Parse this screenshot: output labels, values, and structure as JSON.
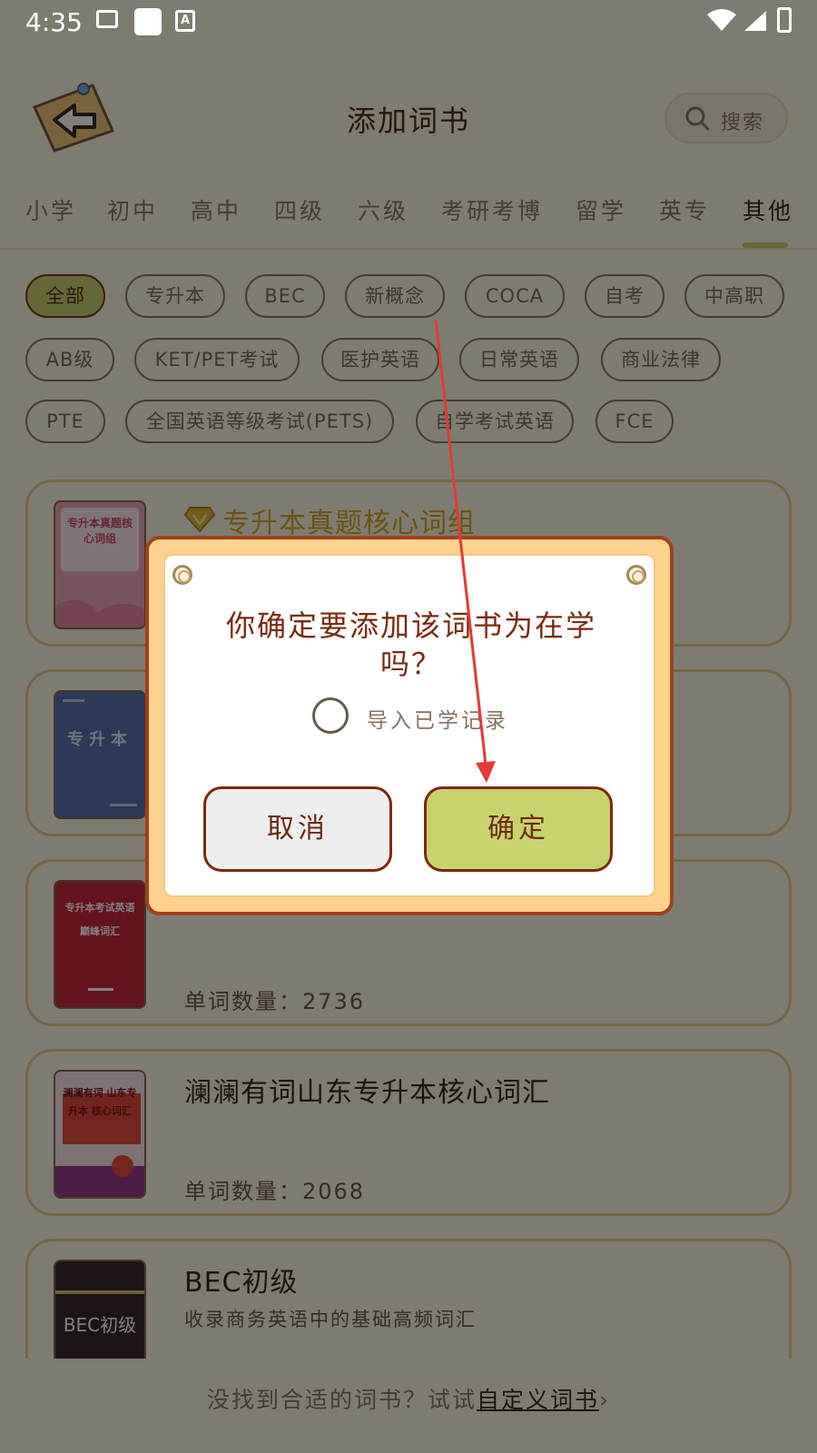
{
  "status_bar": {
    "time": "4:35",
    "a_icon_text": "A"
  },
  "header": {
    "title": "添加词书",
    "search_label": "搜索"
  },
  "tabs": [
    "小学",
    "初中",
    "高中",
    "四级",
    "六级",
    "考研考博",
    "留学",
    "英专",
    "其他"
  ],
  "active_tab": "其他",
  "chips": [
    "全部",
    "专升本",
    "BEC",
    "新概念",
    "COCA",
    "自考",
    "中高职",
    "AB级",
    "KET/PET考试",
    "医护英语",
    "日常英语",
    "商业法律",
    "PTE",
    "全国英语等级考试(PETS)",
    "自学考试英语",
    "FCE"
  ],
  "active_chip": "全部",
  "books": [
    {
      "title": "专升本真题核心词组",
      "premium": true,
      "cover_text": "专升本真题核心词组",
      "cover_color": "#f2a6b8"
    },
    {
      "title": "",
      "cover_text": "专升本",
      "cover_color": "#5a6fb0"
    },
    {
      "title": "",
      "count": "单词数量：2736",
      "cover_text": "专升本考试英语 巅峰词汇",
      "cover_color": "#c8283a"
    },
    {
      "title": "澜澜有词山东专升本核心词汇",
      "count": "单词数量：2068",
      "cover_text": "澜澜有词 山东专升本 核心词汇",
      "cover_color": "#f9e2e6"
    },
    {
      "title": "BEC初级",
      "subtitle": "收录商务英语中的基础高频词汇",
      "cover_text": "BEC初级",
      "cover_color": "#3a2a2a"
    }
  ],
  "footer": {
    "prefix": "没找到合适的词书？试试",
    "link": "自定义词书",
    "chevron": "›"
  },
  "dialog": {
    "message": "你确定要添加该词书为在学吗？",
    "checkbox_label": "导入已学记录",
    "cancel_label": "取消",
    "confirm_label": "确定"
  },
  "colors": {
    "overlay": "rgba(0,0,0,0.5)",
    "accent": "#c9d36e",
    "dialog_border": "#a0401c",
    "arrow": "#e53935"
  }
}
